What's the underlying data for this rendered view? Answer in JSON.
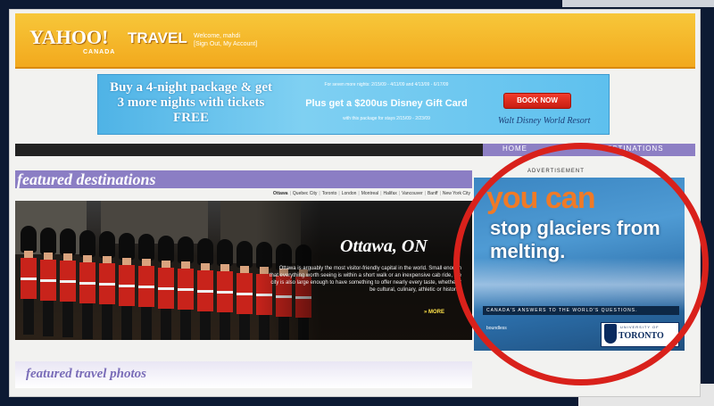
{
  "header": {
    "logo": "YAHOO!",
    "logo_sub": "CANADA",
    "section": "TRAVEL",
    "welcome_line1": "Welcome, mahdi",
    "welcome_line2": "[Sign Out, My Account]"
  },
  "banner_ad": {
    "headline": "Buy a 4-night package & get 3 more nights with tickets FREE",
    "fine_print_1": "For seven more nights: 2/15/09 - 4/11/09 and 4/13/09 - 6/17/09",
    "offer": "Plus get a $200us Disney Gift Card",
    "fine_print_2": "with this package for stays 2/15/09 - 2/23/09",
    "cta": "BOOK NOW",
    "brand": "Walt Disney World Resort"
  },
  "nav": {
    "home": "HOME",
    "destinations": "DESTINATIONS"
  },
  "featured": {
    "title": "featured destinations",
    "cities": [
      "Ottawa",
      "Quebec City",
      "Toronto",
      "London",
      "Montreal",
      "Halifax",
      "Vancouver",
      "Banff",
      "New York City"
    ],
    "hero_city": "Ottawa, ON",
    "hero_desc": "Ottawa is arguably the most visitor-friendly capital in the world. Small enough that everything worth seeing is within a short walk or an inexpensive cab ride, the city is also large enough to have something to offer nearly every taste, whether it be cultural, culinary, athletic or historic.",
    "more": "» MORE"
  },
  "photos": {
    "title": "featured travel photos"
  },
  "side_ad": {
    "label": "ADVERTISEMENT",
    "headline_1": "you can",
    "headline_2": "stop glaciers from melting.",
    "tagline": "CANADA'S ANSWERS TO THE WORLD'S QUESTIONS.",
    "subtag": "boundless",
    "sponsor_small": "UNIVERSITY OF",
    "sponsor": "TORONTO"
  },
  "colors": {
    "header_yellow": "#f2a91d",
    "nav_purple": "#8d7fc4",
    "annotation_red": "#d9211b",
    "ad_orange": "#f07a26"
  }
}
